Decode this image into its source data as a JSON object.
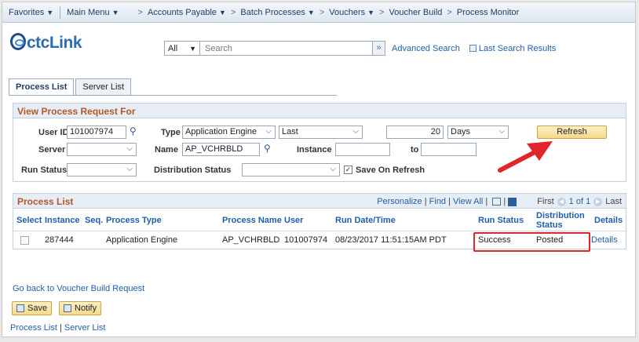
{
  "nav": {
    "favorites": "Favorites",
    "main_menu": "Main Menu",
    "breadcrumbs": [
      "Accounts Payable",
      "Batch Processes",
      "Vouchers",
      "Voucher Build",
      "Process Monitor"
    ]
  },
  "header": {
    "logo_text": "ctcLink",
    "search_scope": "All",
    "search_placeholder": "Search",
    "advanced_search": "Advanced Search",
    "last_search_results": "Last Search Results"
  },
  "tabs": [
    {
      "label": "Process List",
      "active": true
    },
    {
      "label": "Server List",
      "active": false
    }
  ],
  "view_request": {
    "title": "View Process Request For",
    "user_id_label": "User ID",
    "user_id_value": "101007974",
    "type_label": "Type",
    "type_value": "Application Engine",
    "period_value": "Last",
    "count_value": "20",
    "unit_value": "Days",
    "refresh": "Refresh",
    "server_label": "Server",
    "server_value": "",
    "name_label": "Name",
    "name_value": "AP_VCHRBLD",
    "instance_label": "Instance",
    "instance_from": "",
    "to_label": "to",
    "instance_to": "",
    "run_status_label": "Run Status",
    "run_status_value": "",
    "distribution_status_label": "Distribution Status",
    "distribution_status_value": "",
    "save_on_refresh_label": "Save On Refresh",
    "save_on_refresh_checked": true
  },
  "process_list": {
    "title": "Process List",
    "personalize": "Personalize",
    "find": "Find",
    "view_all": "View All",
    "first": "First",
    "range": "1 of 1",
    "last": "Last",
    "columns": [
      "Select",
      "Instance",
      "Seq.",
      "Process Type",
      "Process Name",
      "User",
      "Run Date/Time",
      "Run Status",
      "Distribution Status",
      "Details"
    ],
    "rows": [
      {
        "instance": "287444",
        "seq": "",
        "process_type": "Application Engine",
        "process_name": "AP_VCHRBLD",
        "user": "101007974",
        "run_datetime": "08/23/2017 11:51:15AM PDT",
        "run_status": "Success",
        "distribution_status": "Posted",
        "details": "Details"
      }
    ]
  },
  "footer": {
    "back_link": "Go back to Voucher Build Request",
    "save": "Save",
    "notify": "Notify",
    "process_list_link": "Process List",
    "server_list_link": "Server List",
    "link_separator": "|"
  },
  "colors": {
    "accent": "#b2572a",
    "link": "#1f5fa8",
    "highlight": "#e0262b"
  }
}
